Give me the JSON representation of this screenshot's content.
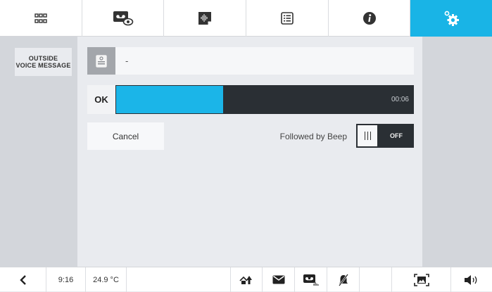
{
  "top_tabs": [
    {
      "name": "apps-grid",
      "active": false
    },
    {
      "name": "voicemail-view",
      "active": false
    },
    {
      "name": "audio-memo",
      "active": false
    },
    {
      "name": "list",
      "active": false
    },
    {
      "name": "info",
      "active": false
    },
    {
      "name": "settings",
      "active": true
    }
  ],
  "colors": {
    "accent": "#19b4e6",
    "dark": "#2a2f34",
    "panel": "#d3d6db"
  },
  "sidebar": {
    "label": "OUTSIDE\nVOICE MESSAGE"
  },
  "message": {
    "icon": "voice-message-icon",
    "text": "-"
  },
  "recording": {
    "status_label": "OK",
    "progress_fraction": 0.36,
    "time": "00:06"
  },
  "actions": {
    "cancel_label": "Cancel"
  },
  "beep": {
    "label": "Followed by Beep",
    "toggle_state": "OFF"
  },
  "status_bar": {
    "time": "9:16",
    "temperature": "24.9 °C",
    "icons": [
      "back-icon",
      "home-icon",
      "mail-icon",
      "voicemail-icon",
      "bell-muted-icon",
      "screen-icon",
      "volume-icon"
    ]
  }
}
